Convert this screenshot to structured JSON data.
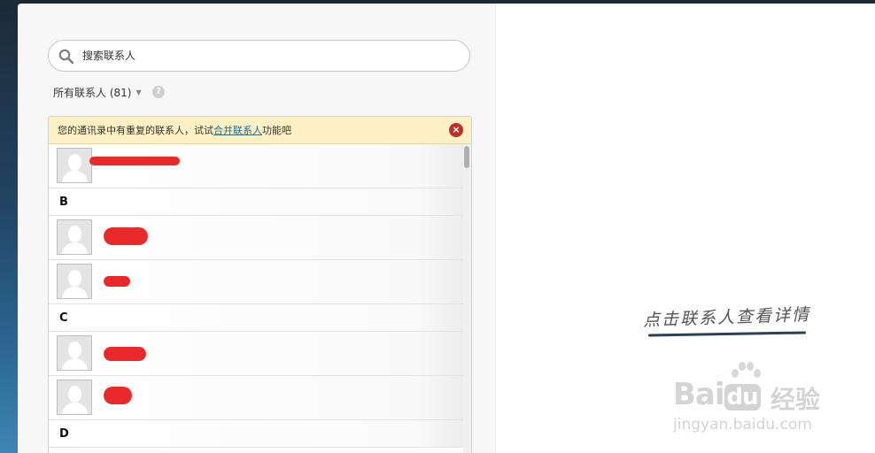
{
  "search": {
    "placeholder": "搜索联系人"
  },
  "filter": {
    "label": "所有联系人 (81)",
    "help": "?"
  },
  "notice": {
    "text_before": "您的通讯录中有重复的联系人，试试",
    "link": "合并联系人",
    "text_after": "功能吧",
    "close": "×"
  },
  "contacts": {
    "c0": {
      "name": ""
    },
    "letter_b": "B",
    "c1": {
      "name": ""
    },
    "c2": {
      "name": ""
    },
    "letter_c": "C",
    "c3": {
      "name": ""
    },
    "c4": {
      "name": ""
    },
    "letter_d": "D"
  },
  "hint": "点击联系人查看详情",
  "watermark": {
    "brand_a": "Bai",
    "brand_b": "du",
    "brand_cn": "经验",
    "url": "jingyan.baidu.com"
  },
  "colors": {
    "accent_link": "#1a6e9d",
    "notice_bg": "#fdf1c3",
    "close_red": "#b8312a",
    "redaction": "#ea2a2a"
  }
}
